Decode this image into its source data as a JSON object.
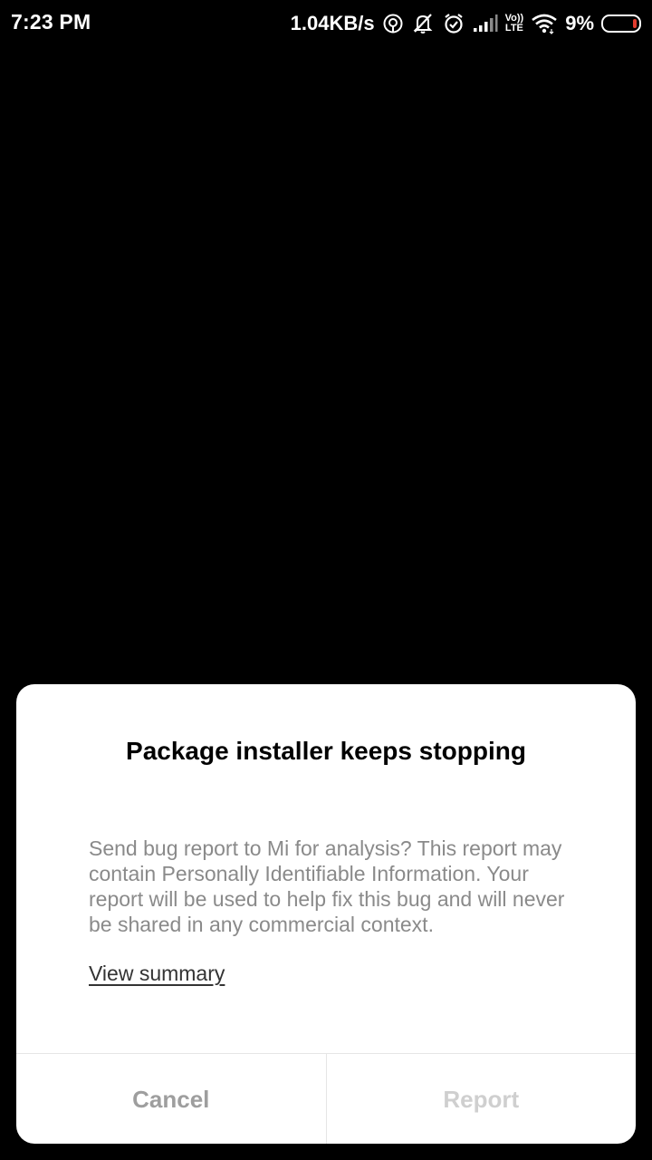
{
  "status_bar": {
    "time": "7:23 PM",
    "net_speed": "1.04KB/s",
    "volte_top": "Vo))",
    "volte_bottom": "LTE",
    "battery_percent": "9%",
    "icons": [
      "hotspot-icon",
      "notifications-off-icon",
      "alarm-icon",
      "signal-icon",
      "volte-icon",
      "wifi-icon",
      "battery-icon"
    ]
  },
  "dialog": {
    "title": "Package installer keeps stopping",
    "message": "Send bug report to Mi for analysis? This report may contain Personally Identifiable Information. Your report will be used to help fix this bug and will never be shared in any commercial context.",
    "link": "View summary",
    "cancel_label": "Cancel",
    "report_label": "Report"
  },
  "colors": {
    "background": "#000000",
    "dialog_bg": "#ffffff",
    "message_text": "#8a8a8a",
    "cancel_text": "#9e9e9e",
    "report_text_disabled": "#cfcfcf",
    "battery_low": "#e23b2e"
  }
}
